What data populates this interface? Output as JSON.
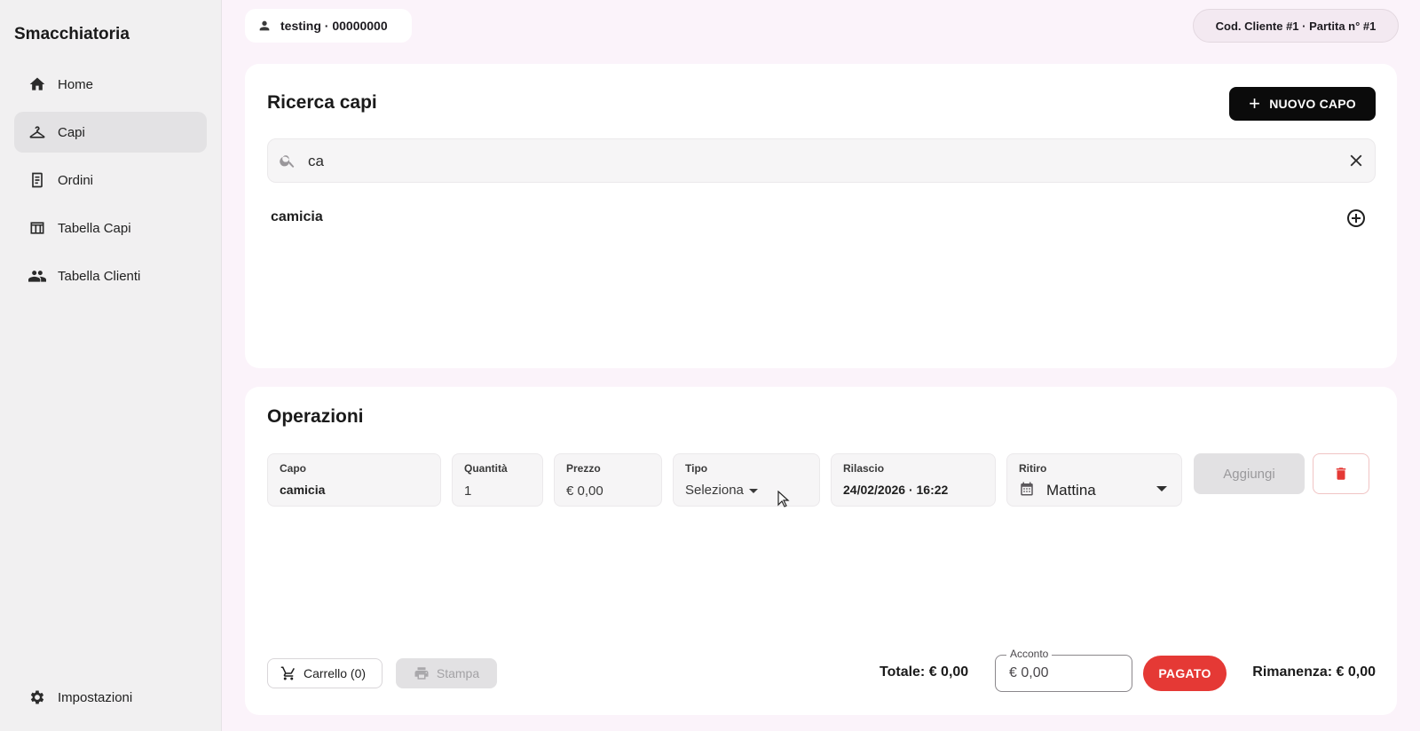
{
  "app": {
    "title": "Smacchiatoria"
  },
  "sidebar": {
    "items": [
      {
        "label": "Home",
        "icon": "home-icon"
      },
      {
        "label": "Capi",
        "icon": "hanger-icon",
        "active": true
      },
      {
        "label": "Ordini",
        "icon": "receipt-icon"
      },
      {
        "label": "Tabella Capi",
        "icon": "table-icon"
      },
      {
        "label": "Tabella Clienti",
        "icon": "people-icon"
      }
    ],
    "settings_label": "Impostazioni"
  },
  "header": {
    "user": "testing · 00000000",
    "client": "Cod. Cliente #1 · Partita n° #1"
  },
  "search": {
    "title": "Ricerca capi",
    "new_button": "NUOVO CAPO",
    "query": "ca",
    "results": [
      {
        "label": "camicia"
      }
    ]
  },
  "operations": {
    "title": "Operazioni",
    "fields": {
      "capo": {
        "label": "Capo",
        "value": "camicia"
      },
      "quantita": {
        "label": "Quantità",
        "value": "1"
      },
      "prezzo": {
        "label": "Prezzo",
        "value": "€ 0,00"
      },
      "tipo": {
        "label": "Tipo",
        "value": "Seleziona"
      },
      "rilascio": {
        "label": "Rilascio",
        "value": "24/02/2026 · 16:22"
      },
      "ritiro": {
        "label": "Ritiro",
        "value": "Mattina"
      }
    },
    "add_button": "Aggiungi",
    "cart_button": "Carrello (0)",
    "print_button": "Stampa",
    "totale": "Totale: € 0,00",
    "acconto_label": "Acconto",
    "acconto_value": "€ 0,00",
    "pagato_button": "PAGATO",
    "rimanenza": "Rimanenza: € 0,00"
  },
  "colors": {
    "accent_black": "#0b0b0b",
    "danger": "#e53935",
    "background": "#fbf3fa",
    "sidebar": "#f1f0f1"
  }
}
